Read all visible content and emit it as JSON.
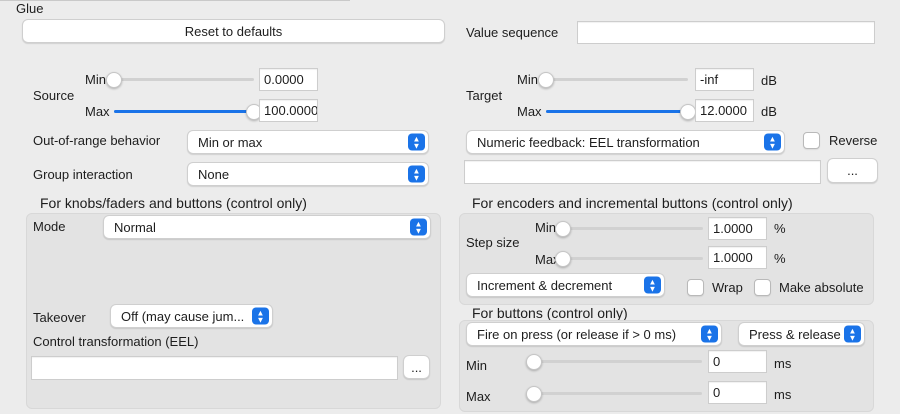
{
  "window": {
    "title": "Glue"
  },
  "reset_button": "Reset to defaults",
  "value_sequence": {
    "label": "Value sequence",
    "value": ""
  },
  "source": {
    "label": "Source",
    "min_label": "Min",
    "max_label": "Max",
    "min_value": "0.0000",
    "max_value": "100.0000",
    "min_level": 0.0,
    "max_level": 1.0
  },
  "target": {
    "label": "Target",
    "min_label": "Min",
    "max_label": "Max",
    "min_value": "-inf",
    "max_value": "12.0000",
    "unit": "dB",
    "min_level": 0.0,
    "max_level": 1.0
  },
  "out_of_range": {
    "label": "Out-of-range behavior",
    "value": "Min or max"
  },
  "group_interaction": {
    "label": "Group interaction",
    "value": "None"
  },
  "feedback": {
    "value": "Numeric feedback: EEL transformation",
    "expression": "",
    "more": "..."
  },
  "reverse": {
    "label": "Reverse",
    "checked": false
  },
  "knobs_section": {
    "title": "For knobs/faders and buttons (control only)",
    "mode_label": "Mode",
    "mode_value": "Normal",
    "takeover_label": "Takeover",
    "takeover_value": "Off (may cause jum...",
    "control_transform_label": "Control transformation (EEL)",
    "control_transform_value": "",
    "more": "..."
  },
  "encoders_section": {
    "title": "For encoders and incremental buttons (control only)",
    "step_size_label": "Step size",
    "min_label": "Min",
    "max_label": "Max",
    "min_value": "1.0000",
    "max_value": "1.0000",
    "unit": "%",
    "min_level": 0.0,
    "max_level": 0.0,
    "increment_value": "Increment & decrement",
    "wrap_label": "Wrap",
    "wrap_checked": false,
    "make_absolute_label": "Make absolute",
    "make_absolute_checked": false
  },
  "buttons_section": {
    "title": "For buttons (control only)",
    "fire_value": "Fire on press (or release if > 0 ms)",
    "press_value": "Press & release",
    "min_label": "Min",
    "max_label": "Max",
    "min_value": "0",
    "max_value": "0",
    "unit": "ms",
    "min_level": 0.0,
    "max_level": 0.0
  },
  "colors": {
    "accent": "#1a73e8",
    "window_bg": "#ececec",
    "group_bg": "#e3e3e3"
  },
  "icons": {
    "chevron": "up-down-chevron-icon"
  }
}
